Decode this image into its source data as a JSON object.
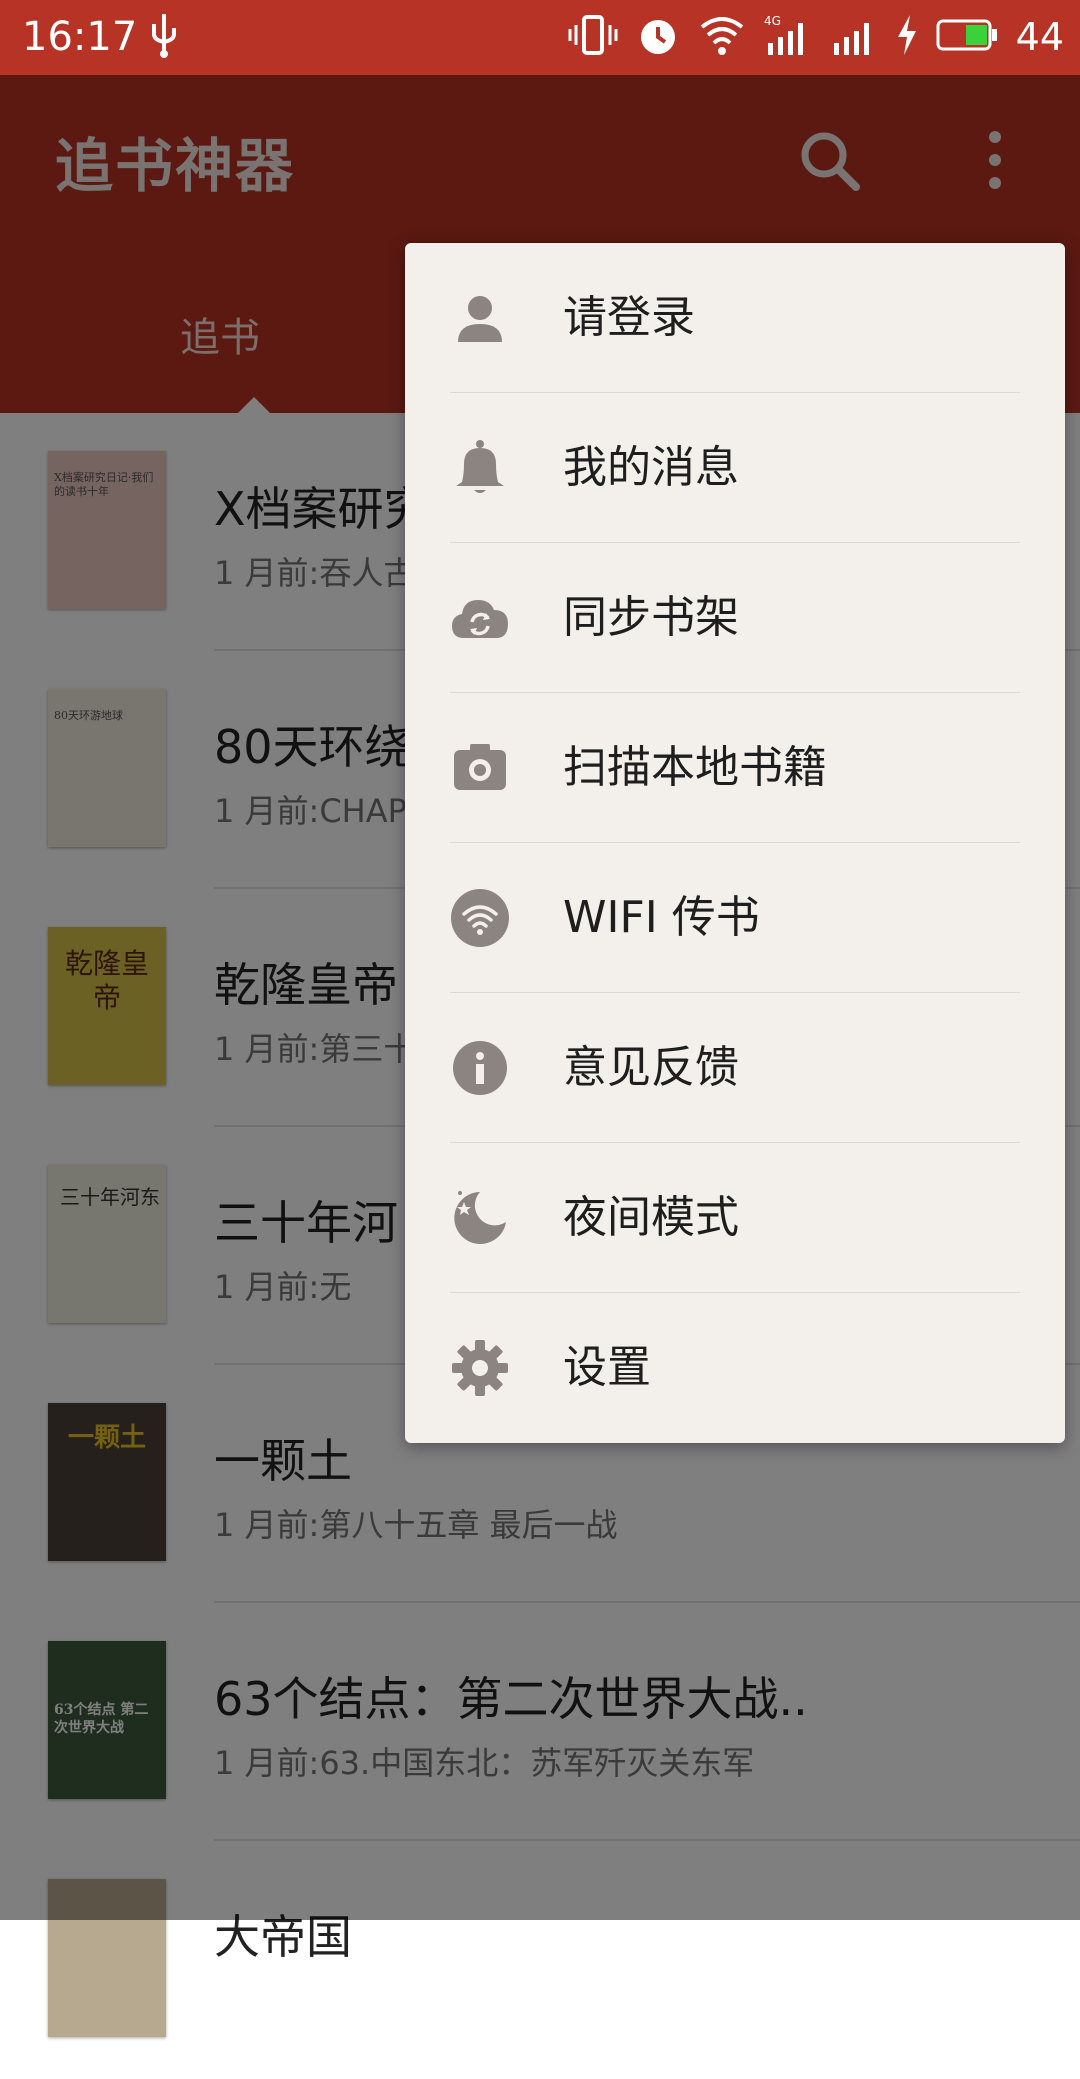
{
  "status_bar": {
    "time": "16:17",
    "battery": "44"
  },
  "app_bar": {
    "title": "追书神器",
    "tab": "追书"
  },
  "books": [
    {
      "title": "X档案研究",
      "subtitle": "1 月前:吞人古",
      "cover_text": "X档案研究日记·我们的读书十年",
      "cover_bg": "#ecc8c0"
    },
    {
      "title": "80天环绕",
      "subtitle": "1 月前:CHAP",
      "cover_text": "80天环游地球",
      "cover_bg": "#f3ece0"
    },
    {
      "title": "乾隆皇帝",
      "subtitle": "1 月前:第三十",
      "cover_text": "乾隆皇帝",
      "cover_bg": "#d8c24a"
    },
    {
      "title": "三十年河",
      "subtitle": "1 月前:无",
      "cover_text": "三十年河东",
      "cover_bg": "#efeddf"
    },
    {
      "title": "一颗土",
      "subtitle": "1 月前:第八十五章 最后一战",
      "cover_text": "一颗土",
      "cover_bg": "#4a4036"
    },
    {
      "title": "63个结点：第二次世界大战..",
      "subtitle": "1 月前:63.中国东北：苏军歼灭关东军",
      "cover_text": "63个结点 第二次世界大战",
      "cover_bg": "#3f5a3d"
    },
    {
      "title": "大帝国",
      "subtitle": "",
      "cover_text": "",
      "cover_bg": "#b7a98f"
    }
  ],
  "menu": {
    "items": [
      {
        "label": "请登录",
        "icon": "user-icon"
      },
      {
        "label": "我的消息",
        "icon": "bell-icon"
      },
      {
        "label": "同步书架",
        "icon": "cloud-sync-icon"
      },
      {
        "label": "扫描本地书籍",
        "icon": "camera-icon"
      },
      {
        "label": "WIFI 传书",
        "icon": "wifi-icon"
      },
      {
        "label": "意见反馈",
        "icon": "info-icon"
      },
      {
        "label": "夜间模式",
        "icon": "moon-icon"
      },
      {
        "label": "设置",
        "icon": "gear-icon"
      }
    ]
  },
  "colors": {
    "primary": "#b73325",
    "menu_bg": "#f3f0eb",
    "icon_gray": "#8c8480"
  }
}
